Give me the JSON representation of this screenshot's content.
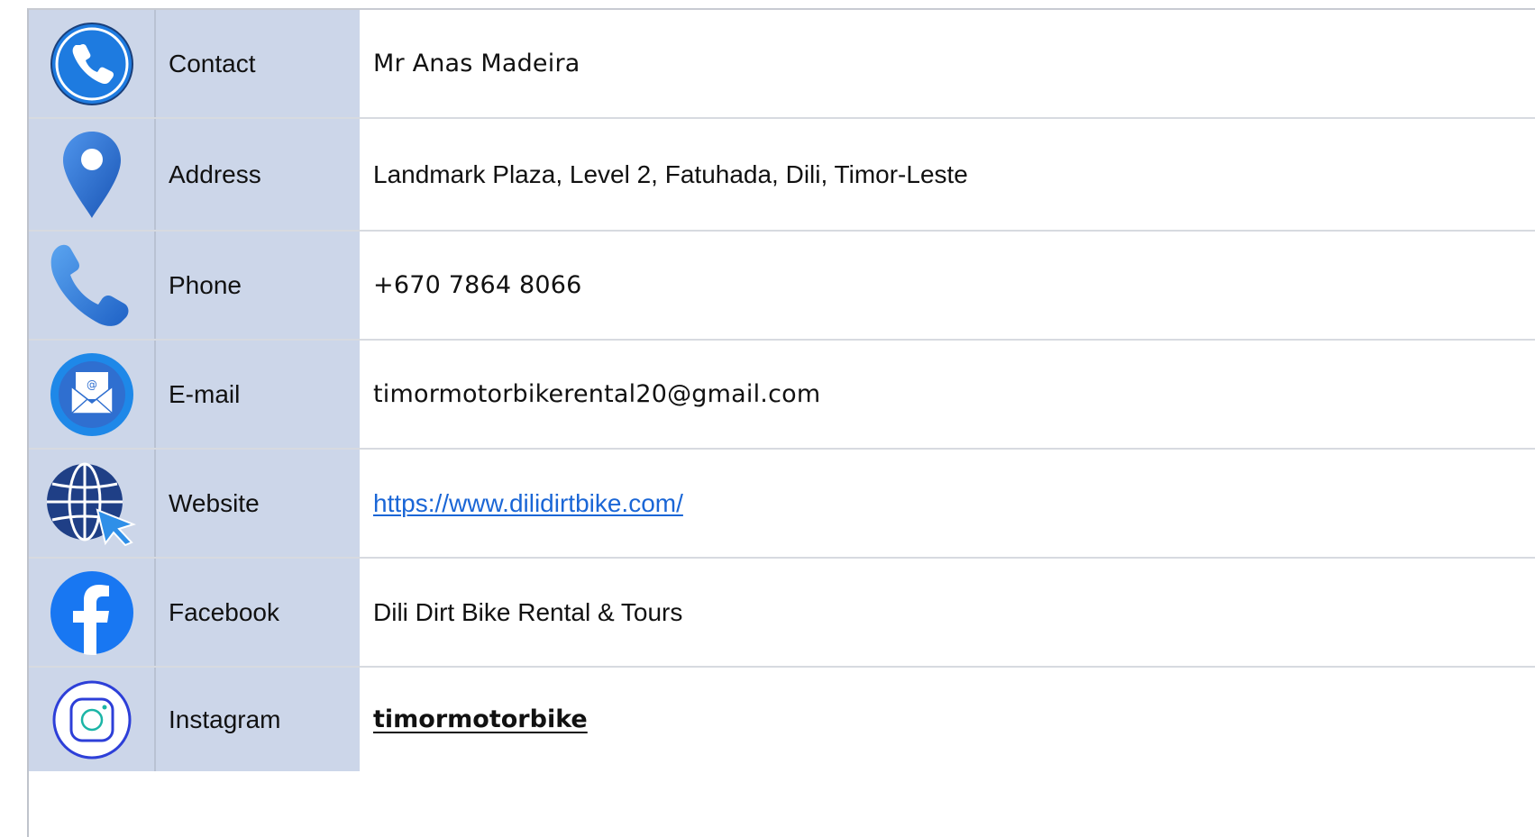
{
  "contact_table": {
    "rows": [
      {
        "label": "Contact",
        "value": "Mr Anas Madeira",
        "icon": "phone-circle-icon"
      },
      {
        "label": "Address",
        "value": "Landmark Plaza, Level 2, Fatuhada, Dili, Timor-Leste",
        "icon": "location-pin-icon"
      },
      {
        "label": "Phone",
        "value": "+670 7864 8066",
        "icon": "phone-handset-icon"
      },
      {
        "label": "E-mail",
        "value": "timormotorbikerental20@gmail.com",
        "icon": "email-envelope-icon"
      },
      {
        "label": "Website",
        "value": "https://www.dilidirtbike.com/",
        "icon": "globe-cursor-icon"
      },
      {
        "label": "Facebook",
        "value": "Dili Dirt Bike Rental & Tours",
        "icon": "facebook-icon"
      },
      {
        "label": "Instagram",
        "value": "timormotorbike",
        "icon": "instagram-icon"
      }
    ]
  },
  "colors": {
    "label_bg": "#ccd6e9",
    "link": "#1a66d6",
    "icon_blue": "#1e7be0",
    "globe_navy": "#1f3f86"
  }
}
